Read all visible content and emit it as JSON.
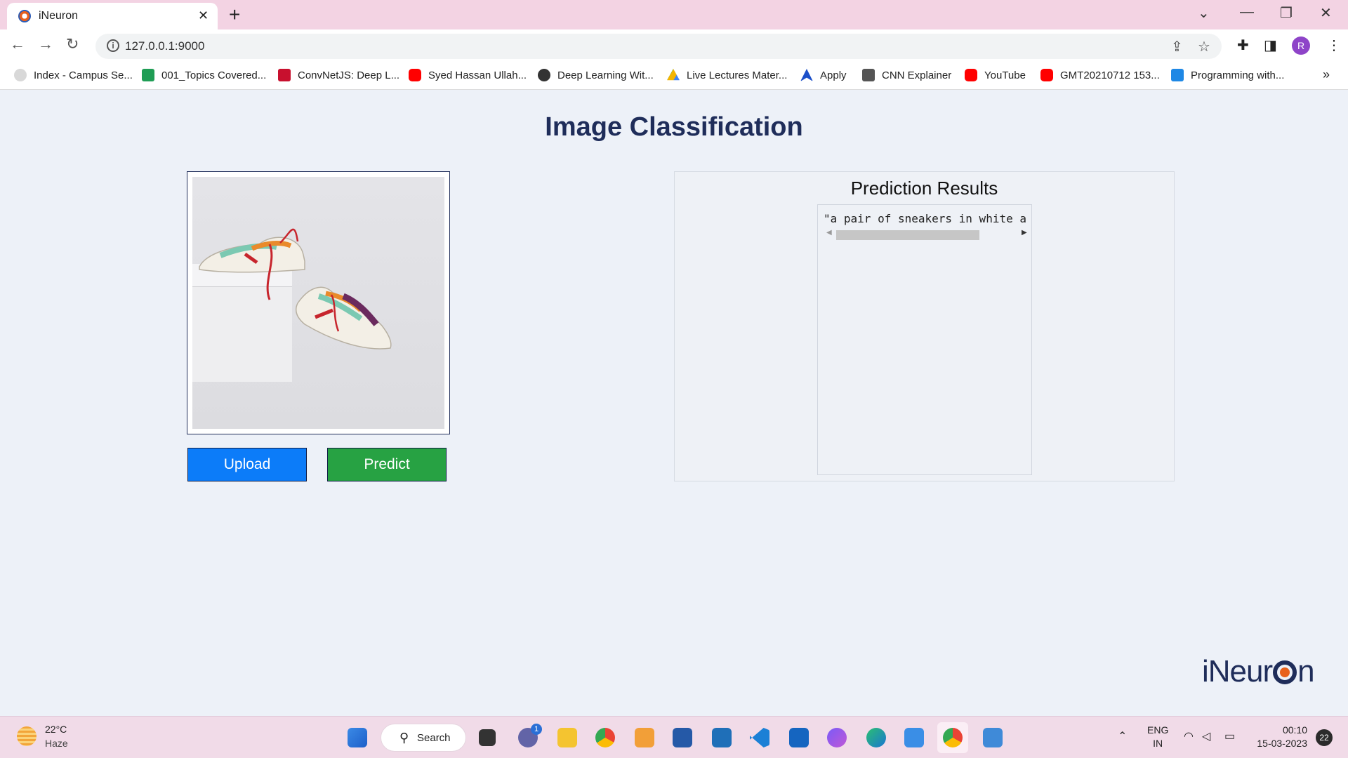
{
  "browser": {
    "tab_title": "iNeuron",
    "url": "127.0.0.1:9000",
    "profile_initial": "R",
    "bookmarks": [
      {
        "label": "Index - Campus Se...",
        "icon": "campus-icon",
        "color": "#b8b8b8"
      },
      {
        "label": "001_Topics Covered...",
        "icon": "sheets-icon",
        "color": "#1f9d55"
      },
      {
        "label": "ConvNetJS: Deep L...",
        "icon": "s-icon",
        "color": "#c8102e"
      },
      {
        "label": "Syed Hassan Ullah...",
        "icon": "youtube-icon",
        "color": "#ff0000"
      },
      {
        "label": "Deep Learning Wit...",
        "icon": "globe-icon",
        "color": "#333333"
      },
      {
        "label": "Live Lectures Mater...",
        "icon": "drive-icon",
        "color": "#f4b400"
      },
      {
        "label": "Apply",
        "icon": "apply-icon",
        "color": "#1b4fc9"
      },
      {
        "label": "CNN Explainer",
        "icon": "cnn-explainer-icon",
        "color": "#555555"
      },
      {
        "label": "YouTube",
        "icon": "youtube-icon",
        "color": "#ff0000"
      },
      {
        "label": "GMT20210712 153...",
        "icon": "youtube-icon",
        "color": "#ff0000"
      },
      {
        "label": "Programming with...",
        "icon": "is-icon",
        "color": "#1e88e5"
      }
    ]
  },
  "page": {
    "title": "Image Classification",
    "upload_label": "Upload",
    "predict_label": "Predict",
    "results_title": "Prediction Results",
    "results_text": "\"a pair of sneakers in white ar",
    "logo_text_start": "iNeur",
    "logo_text_end": "n"
  },
  "taskbar": {
    "temperature": "22°C",
    "weather": "Haze",
    "search_label": "Search",
    "chat_badge": "1",
    "lang_1": "ENG",
    "lang_2": "IN",
    "time": "00:10",
    "date": "15-03-2023",
    "notification_count": "22"
  },
  "colors": {
    "title": "#1f2d5a",
    "upload_button": "#0c7cf9",
    "predict_button": "#27a243",
    "logo_accent": "#e8611c"
  }
}
